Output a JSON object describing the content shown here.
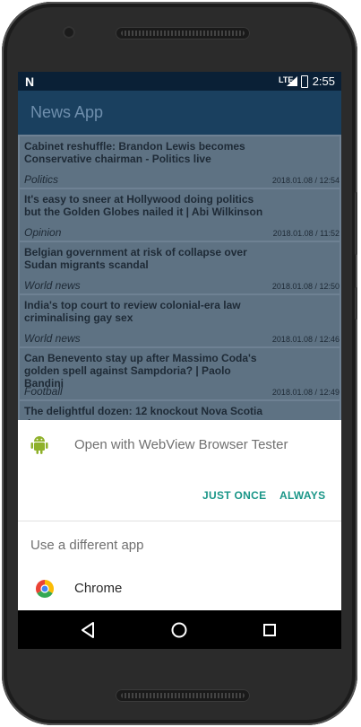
{
  "status_bar": {
    "network_indicator": "N",
    "signal_label": "LTE",
    "time": "2:55"
  },
  "app_bar": {
    "title": "News App"
  },
  "news_items": [
    {
      "headline": "Cabinet reshuffle: Brandon Lewis becomes Conservative chairman - Politics live",
      "section": "Politics",
      "date": "2018.01.08 / 12:54"
    },
    {
      "headline": "It's easy to sneer at Hollywood doing politics but the Golden Globes nailed it | Abi Wilkinson",
      "section": "Opinion",
      "date": "2018.01.08 / 11:52"
    },
    {
      "headline": "Belgian government at risk of collapse over Sudan migrants scandal",
      "section": "World news",
      "date": "2018.01.08 / 12:50"
    },
    {
      "headline": "India's top court to review colonial-era law criminalising gay sex",
      "section": "World news",
      "date": "2018.01.08 / 12:46"
    },
    {
      "headline": "Can Benevento stay up after Massimo Coda's golden spell against Sampdoria? | Paolo Bandini",
      "section": "Football",
      "date": "2018.01.08 / 12:49"
    },
    {
      "headline": "The delightful dozen: 12 knockout Nova Scotia tips",
      "section": "",
      "date": ""
    }
  ],
  "chooser": {
    "open_with_text": "Open with WebView Browser Tester",
    "just_once_label": "JUST ONCE",
    "always_label": "ALWAYS",
    "different_app_text": "Use a different app",
    "alt_app_label": "Chrome",
    "app_icon": "android-robot-icon",
    "alt_app_icon": "chrome-icon"
  },
  "colors": {
    "accent": "#1a9688",
    "app_bar": "#1a405f",
    "status_bar": "#0a2036"
  }
}
